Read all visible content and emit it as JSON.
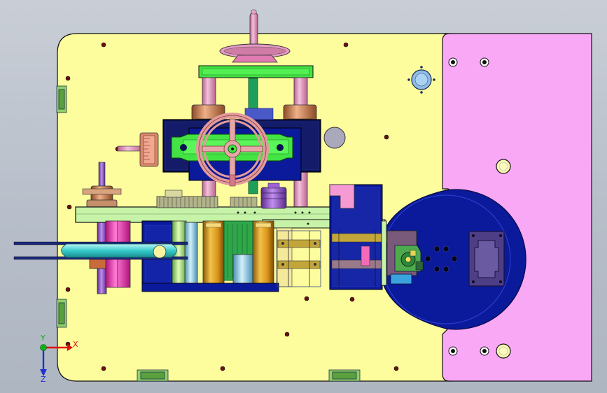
{
  "view": {
    "background": "#bcc3cd",
    "colors": {
      "base_plate": "#fdfd9e",
      "side_plate": "#f9a8f6",
      "blue_block": "#0a1a9a",
      "dark_navy": "#0b1250",
      "bright_green": "#43e343",
      "light_green": "#c6f3a8",
      "pink_post": "#e79ac4",
      "rose_wheel": "#e39a9c",
      "magenta": "#f03ab8",
      "gold": "#e0a51c",
      "light_blue": "#8fd3ea",
      "cyan": "#40d0d0",
      "purple": "#9a4fd2",
      "green_bracket": "#7cc34a"
    },
    "icons": [
      "handwheel-icon",
      "lock-knob-icon",
      "triad-icon"
    ]
  },
  "triad": {
    "x_label": "X",
    "y_label": "Y",
    "z_label": "Z",
    "x_color": "#e01010",
    "y_color": "#10b010",
    "z_color": "#2030d0"
  }
}
